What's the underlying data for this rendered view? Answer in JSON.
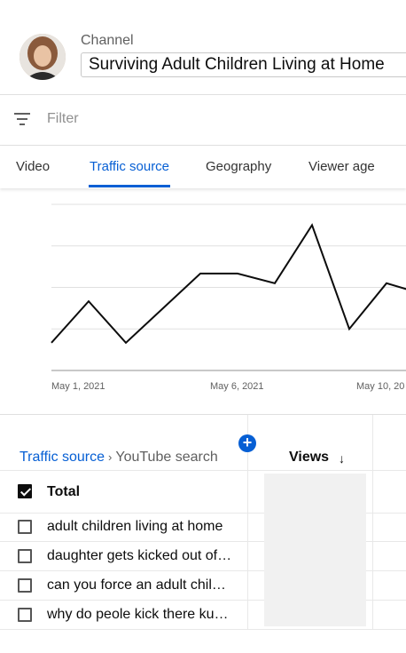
{
  "header": {
    "channel_label": "Channel",
    "channel_name": "Surviving Adult Children Living at Home"
  },
  "filter": {
    "placeholder": "Filter",
    "icon": "filter-icon"
  },
  "tabs": [
    {
      "label": "Video",
      "active": false
    },
    {
      "label": "Traffic source",
      "active": true
    },
    {
      "label": "Geography",
      "active": false
    },
    {
      "label": "Viewer age",
      "active": false
    }
  ],
  "colors": {
    "accent": "#065fd4",
    "line": "#0d0d0d",
    "grid": "#e0e0e0"
  },
  "chart_data": {
    "type": "line",
    "x_tick_labels": [
      "May 1, 2021",
      "May 6, 2021",
      "May 10, 20"
    ],
    "series": [
      {
        "values": [
          2,
          5,
          2,
          4.5,
          7,
          7,
          6.3,
          10.5,
          3,
          6.3,
          5.5
        ]
      }
    ],
    "ylim": [
      0,
      12
    ],
    "grid": true
  },
  "table": {
    "breadcrumb_link": "Traffic source",
    "breadcrumb_separator": "›",
    "breadcrumb_current": "YouTube search",
    "views_header": "Views",
    "sort_icon": "↓",
    "add_icon": "+",
    "rows": [
      {
        "label": "Total",
        "checked": true
      },
      {
        "label": "adult children living at home",
        "checked": false
      },
      {
        "label": "daughter gets kicked out of…",
        "checked": false
      },
      {
        "label": "can you force an adult chil…",
        "checked": false
      },
      {
        "label": "why do peole kick there ku…",
        "checked": false
      }
    ]
  }
}
